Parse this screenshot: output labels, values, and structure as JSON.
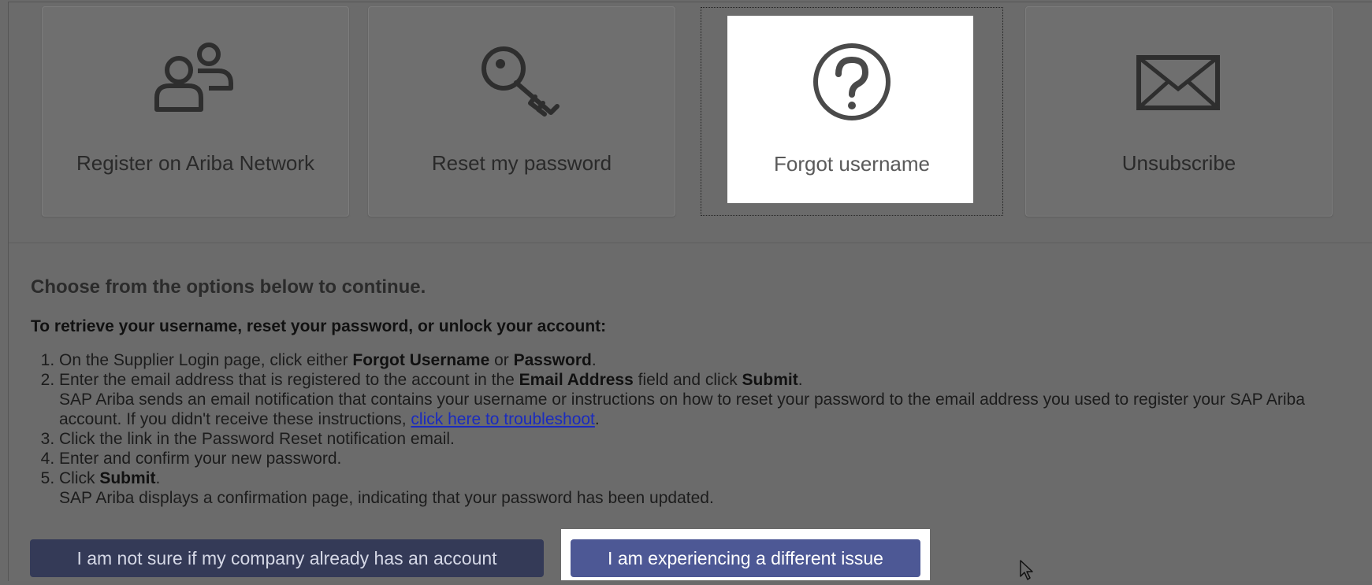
{
  "tiles": [
    {
      "label": "Register on Ariba Network",
      "icon": "users-icon"
    },
    {
      "label": "Reset my password",
      "icon": "key-icon"
    },
    {
      "label": "Forgot username",
      "icon": "question-circle-icon"
    },
    {
      "label": "Unsubscribe",
      "icon": "envelope-icon"
    }
  ],
  "content": {
    "heading": "Choose from the options below to continue.",
    "subheading": "To retrieve your username, reset your password, or unlock your account:",
    "step1": {
      "pre": "On the Supplier Login page, click either ",
      "b1": "Forgot Username",
      "mid": " or ",
      "b2": "Password",
      "post": "."
    },
    "step2": {
      "pre": "Enter the email address that is registered to the account in the ",
      "b1": "Email Address",
      "mid": " field and click ",
      "b2": "Submit",
      "post": ".",
      "detail1": "SAP Ariba sends an email notification that contains your username or instructions on how to reset your password to the email address you used to register your SAP Ariba account. If you didn't receive these instructions, ",
      "link": "click here to troubleshoot",
      "detail2": "."
    },
    "step3": "Click the link in the Password Reset notification email.",
    "step4": "Enter and confirm your new password.",
    "step5": {
      "pre": "Click ",
      "b1": "Submit",
      "post": ".",
      "detail": "SAP Ariba displays a confirmation page, indicating that your password has been updated."
    }
  },
  "buttons": {
    "not_sure": "I am not sure if my company already has an account",
    "different_issue": "I am experiencing a different issue"
  },
  "colors": {
    "overlay": "#6b6b6b",
    "primary_button": "#4d5895",
    "dark_button": "#343a57",
    "link": "#1a2bbf"
  }
}
